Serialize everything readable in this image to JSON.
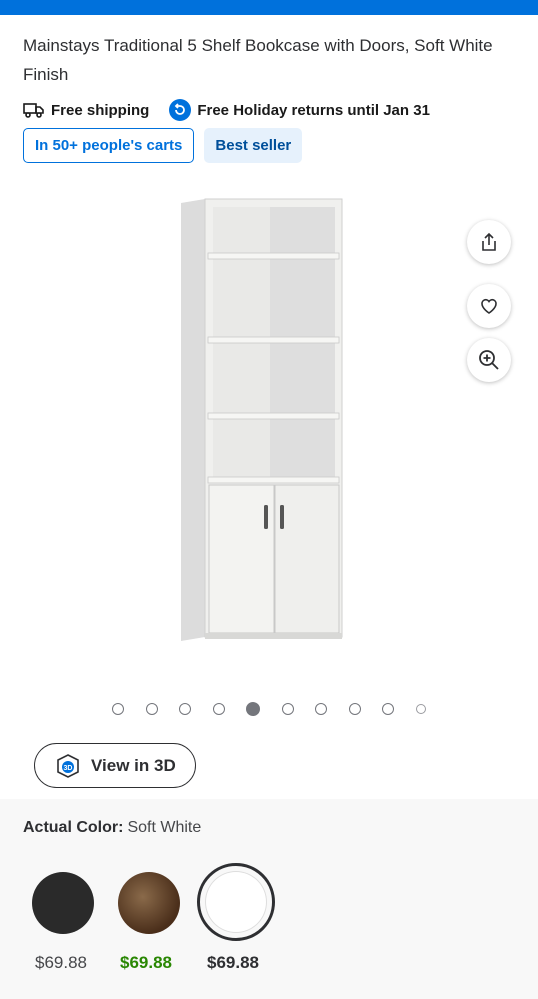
{
  "product": {
    "title": "Mainstays Traditional 5 Shelf Bookcase with Doors, Soft White Finish"
  },
  "fulfillment": {
    "shipping": "Free shipping",
    "returns": "Free Holiday returns until Jan 31"
  },
  "badges": {
    "carts": "In 50+ people's carts",
    "best": "Best seller"
  },
  "gallery": {
    "dot_count": 10,
    "active_index": 4,
    "view3d_label": "View in 3D"
  },
  "actions": {
    "share_icon": "share-icon",
    "favorite_icon": "heart-icon",
    "zoom_icon": "zoom-in-icon"
  },
  "color": {
    "label": "Actual Color:",
    "value": "Soft White"
  },
  "variants": [
    {
      "color_name": "black",
      "swatch_color": "#2a2a2a",
      "price": "$69.88",
      "price_color": "#46474a"
    },
    {
      "color_name": "espresso",
      "swatch_color": "#5a3c26",
      "price": "$69.88",
      "price_color": "#2a8703"
    },
    {
      "color_name": "soft-white",
      "swatch_color": "#ffffff",
      "price": "$69.88",
      "price_color": "#2e2f32"
    }
  ],
  "colors": {
    "brand_blue": "#0071dc",
    "sale_green": "#2a8703"
  }
}
